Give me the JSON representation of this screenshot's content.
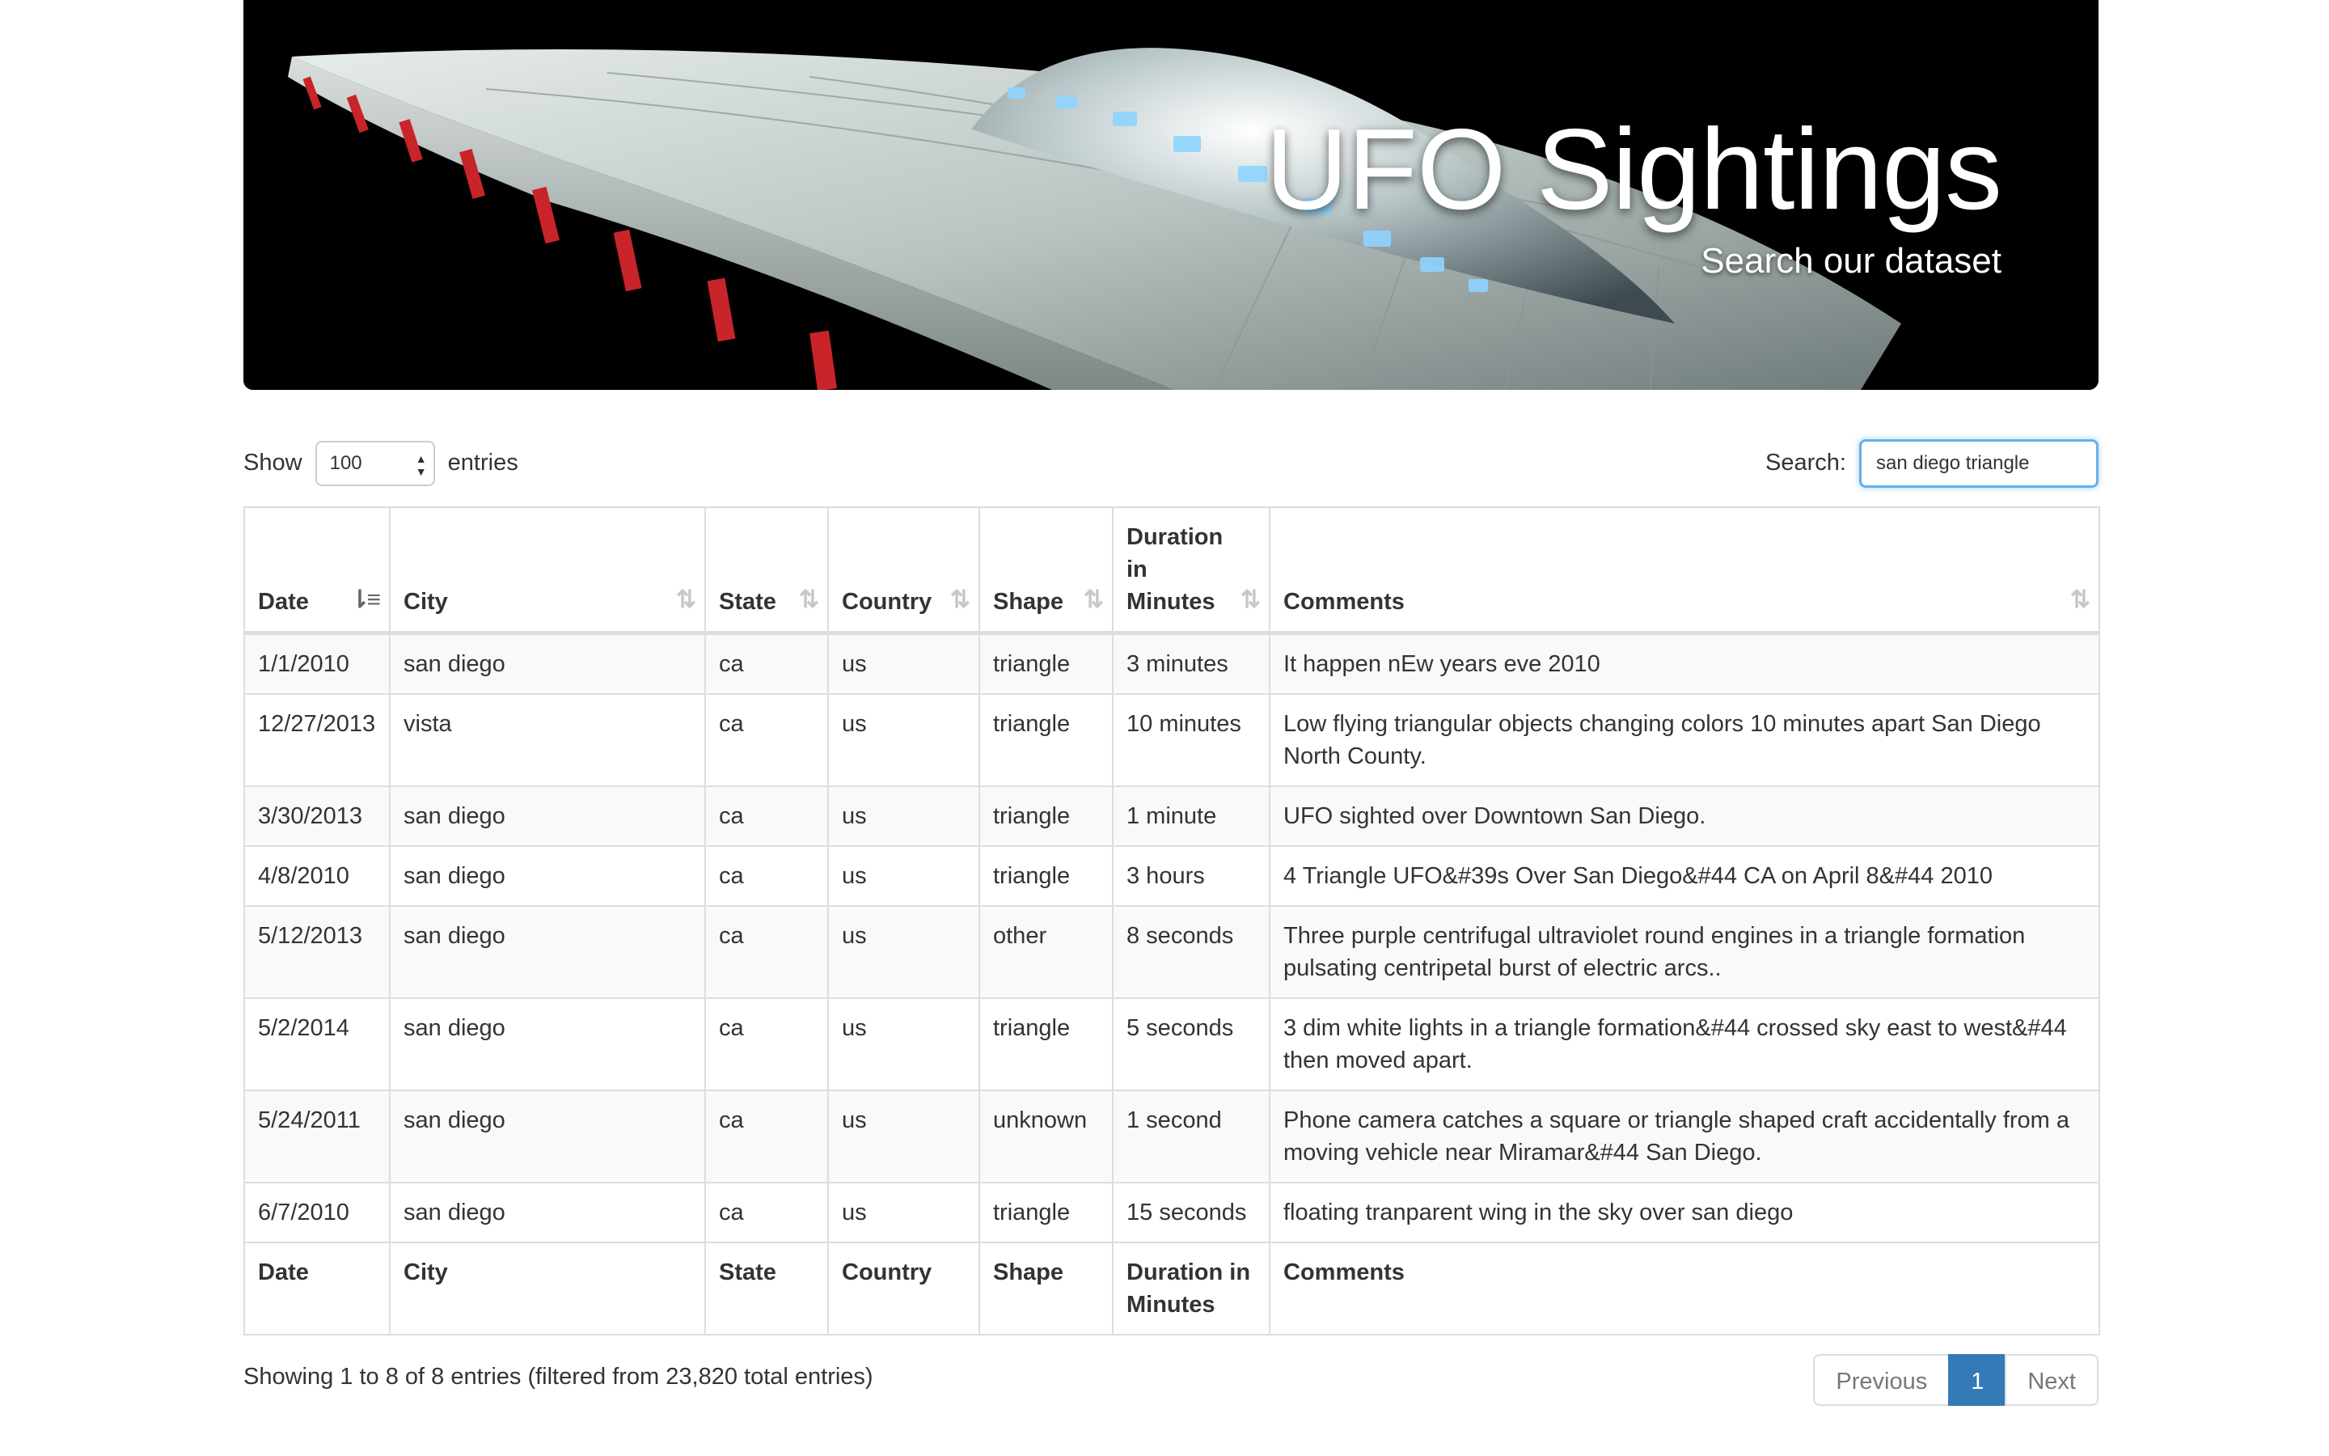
{
  "banner": {
    "title": "UFO Sightings",
    "subtitle": "Search our dataset"
  },
  "controls": {
    "show_label": "Show",
    "page_length": "100",
    "entries_label": "entries",
    "search_label": "Search:",
    "search_value": "san diego triangle"
  },
  "table": {
    "columns": [
      "Date",
      "City",
      "State",
      "Country",
      "Shape",
      "Duration in Minutes",
      "Comments"
    ],
    "sorted_column": "Date",
    "rows": [
      [
        "1/1/2010",
        "san diego",
        "ca",
        "us",
        "triangle",
        "3 minutes",
        "It happen nEw years eve 2010"
      ],
      [
        "12/27/2013",
        "vista",
        "ca",
        "us",
        "triangle",
        "10 minutes",
        "Low flying triangular objects changing colors 10 minutes apart San Diego North County."
      ],
      [
        "3/30/2013",
        "san diego",
        "ca",
        "us",
        "triangle",
        "1 minute",
        "UFO sighted over Downtown San Diego."
      ],
      [
        "4/8/2010",
        "san diego",
        "ca",
        "us",
        "triangle",
        "3 hours",
        "4 Triangle UFO&#39s Over San Diego&#44 CA on April 8&#44 2010"
      ],
      [
        "5/12/2013",
        "san diego",
        "ca",
        "us",
        "other",
        "8 seconds",
        "Three purple centrifugal ultraviolet round engines in a triangle formation pulsating centripetal burst of electric arcs.."
      ],
      [
        "5/2/2014",
        "san diego",
        "ca",
        "us",
        "triangle",
        "5 seconds",
        "3 dim white lights in a triangle formation&#44 crossed sky east to west&#44 then moved apart."
      ],
      [
        "5/24/2011",
        "san diego",
        "ca",
        "us",
        "unknown",
        "1 second",
        "Phone camera catches a square or triangle shaped craft accidentally from a moving vehicle near Miramar&#44 San Diego."
      ],
      [
        "6/7/2010",
        "san diego",
        "ca",
        "us",
        "triangle",
        "15 seconds",
        "floating tranparent wing in the sky over san diego"
      ]
    ]
  },
  "footer": {
    "info": "Showing 1 to 8 of 8 entries (filtered from 23,820 total entries)",
    "previous": "Previous",
    "current_page": "1",
    "next": "Next"
  },
  "colors": {
    "accent": "#337ab7",
    "focus": "#66afe9"
  }
}
